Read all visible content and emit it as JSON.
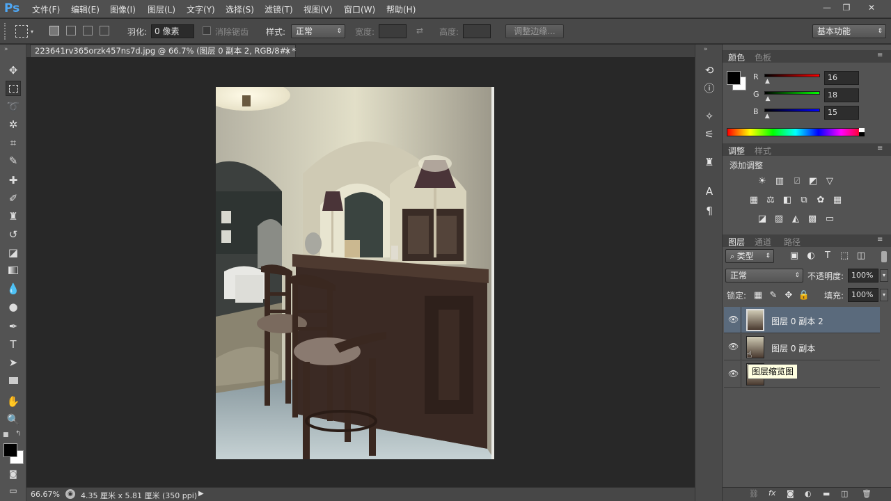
{
  "app": {
    "logo": "Ps"
  },
  "menu": [
    "文件(F)",
    "编辑(E)",
    "图像(I)",
    "图层(L)",
    "文字(Y)",
    "选择(S)",
    "滤镜(T)",
    "视图(V)",
    "窗口(W)",
    "帮助(H)"
  ],
  "window_buttons": {
    "minimize": "—",
    "restore": "❐",
    "close": "✕"
  },
  "options": {
    "feather_label": "羽化:",
    "feather_value": "0 像素",
    "antialias_label": "消除锯齿",
    "style_label": "样式:",
    "style_value": "正常",
    "width_label": "宽度:",
    "height_label": "高度:",
    "refine_button": "调整边缘...",
    "workspace": "基本功能"
  },
  "document": {
    "tab_title": "223641rv365orzk457ns7d.jpg @ 66.7% (图层 0 副本 2, RGB/8#) *",
    "tab_close": "×"
  },
  "status": {
    "zoom": "66.67%",
    "doc_info": "4.35 厘米 x 5.81 厘米 (350 ppi)"
  },
  "color_panel": {
    "tabs": [
      "颜色",
      "色板"
    ],
    "r_label": "R",
    "g_label": "G",
    "b_label": "B",
    "r": "16",
    "g": "18",
    "b": "15",
    "r_level": 0.063,
    "g_level": 0.071,
    "b_level": 0.059
  },
  "adjust_panel": {
    "tabs": [
      "调整",
      "样式"
    ],
    "heading": "添加调整"
  },
  "layers_panel": {
    "tabs": [
      "图层",
      "通道",
      "路径"
    ],
    "filter_kind": "类型",
    "blend_mode": "正常",
    "opacity_label": "不透明度:",
    "opacity_value": "100%",
    "lock_label": "锁定:",
    "fill_label": "填充:",
    "fill_value": "100%",
    "layers": [
      {
        "name": "图层 0 副本 2",
        "selected": true
      },
      {
        "name": "图层 0 副本",
        "selected": false
      },
      {
        "name": "",
        "selected": false
      }
    ],
    "tooltip": "图层缩览图"
  },
  "colors": {
    "accent": "#4fa8f5",
    "selected_layer": "#5a6a7c",
    "foreground": "#000000",
    "background": "#ffffff"
  }
}
